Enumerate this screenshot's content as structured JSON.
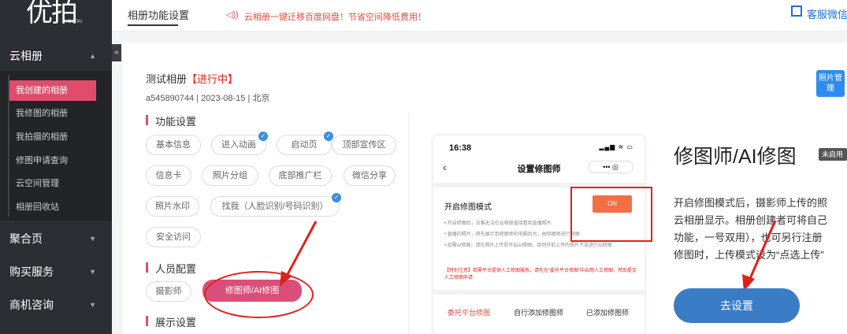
{
  "logo": {
    "text": "优拍",
    "sub": "YOUPAI"
  },
  "sidebar": {
    "groups": [
      {
        "label": "云相册"
      },
      {
        "label": "聚合页"
      },
      {
        "label": "购买服务"
      },
      {
        "label": "商机咨询"
      }
    ],
    "items": [
      {
        "label": "我创建的相册"
      },
      {
        "label": "我修图的相册"
      },
      {
        "label": "我拍摄的相册"
      },
      {
        "label": "修图申请查询"
      },
      {
        "label": "云空间管理"
      },
      {
        "label": "相册回收站"
      }
    ]
  },
  "topbar": {
    "title": "相册功能设置",
    "notice": "云相册一键迁移百度网盘！节省空间降低费用！",
    "service": "客服微信"
  },
  "album": {
    "name": "测试相册",
    "status": "【进行中】",
    "meta": "a545890744  |  2023-08-15  |  北京"
  },
  "sections": {
    "features": "功能设置",
    "staff": "人员配置",
    "display": "展示设置"
  },
  "feature_pills": [
    {
      "label": "基本信息"
    },
    {
      "label": "进入动画"
    },
    {
      "label": "启动页"
    },
    {
      "label": "顶部宣传区"
    },
    {
      "label": "信息卡"
    },
    {
      "label": "照片分组"
    },
    {
      "label": "底部推广栏"
    },
    {
      "label": "微信分享"
    },
    {
      "label": "照片水印"
    },
    {
      "label": "找我（人脸识别/号码识别）"
    },
    {
      "label": "安全访问"
    }
  ],
  "staff_pills": [
    {
      "label": "摄影师"
    },
    {
      "label": "修图师/AI修图"
    }
  ],
  "phone": {
    "time": "16:38",
    "title": "设置修图师",
    "menu": "•••  ◎",
    "mode": "开启修图模式",
    "toggle": "ON",
    "lines": [
      "• 开启修图后，访客无法在云相册直接看到直播照片",
      "• 直播的照片，将先展示到修图师的电脑后台，由修图师进行修图",
      "• 如需AI修图，请在照片上传前开启AI修图。否则开前上传的照片不会进行AI修图"
    ],
    "warn": "【特别注意】若需平台提供人工修图服务，请先在“委托平台修图”中启用人工修图，然后提交人工修图申请",
    "tabs": [
      "委托平台修图",
      "自行添加修图师",
      "已添加修图师"
    ]
  },
  "ai": {
    "title": "修图师/AI修图",
    "badge": "未启用",
    "desc": [
      "开启修图模式后，摄影师上传的照",
      "云相册显示。相册创建者可将自己",
      "功能，一号双用），也可另行注册",
      "修图时，上传模式设为“点选上传”"
    ],
    "button": "去设置"
  },
  "photo_mgr": "照片管理",
  "colors": {
    "accent": "#e14c6d",
    "primary": "#3a7cc6",
    "danger": "#e0211b"
  }
}
